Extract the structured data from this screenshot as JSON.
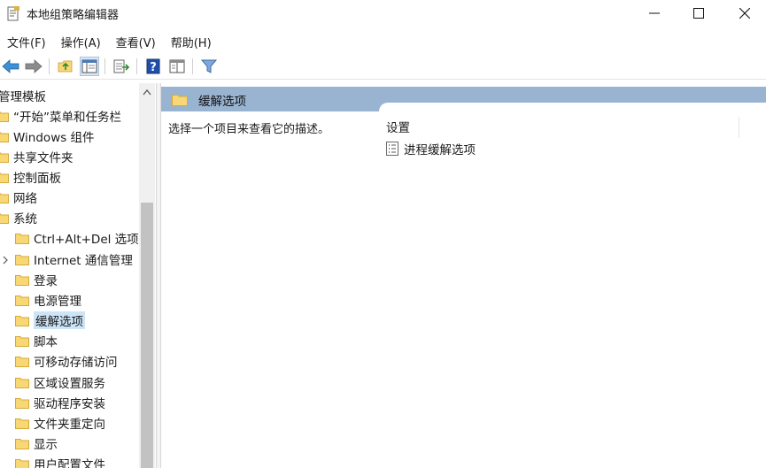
{
  "window": {
    "title": "本地组策略编辑器",
    "controls": {
      "minimize": "minimize",
      "maximize": "maximize",
      "close": "close"
    }
  },
  "menu": [
    {
      "label": "文件(F)"
    },
    {
      "label": "操作(A)"
    },
    {
      "label": "查看(V)"
    },
    {
      "label": "帮助(H)"
    }
  ],
  "toolbar": {
    "buttons": [
      "back-arrow-icon",
      "forward-arrow-icon",
      "up-folder-icon",
      "show-hide-tree-icon",
      "export-list-icon",
      "help-icon",
      "properties-view-icon",
      "filter-icon"
    ]
  },
  "tree": {
    "items": [
      {
        "label": "管理模板",
        "level": 0
      },
      {
        "label": "“开始”菜单和任务栏",
        "level": 1
      },
      {
        "label": "Windows 组件",
        "level": 1
      },
      {
        "label": "共享文件夹",
        "level": 1
      },
      {
        "label": "控制面板",
        "level": 1
      },
      {
        "label": "网络",
        "level": 1
      },
      {
        "label": "系统",
        "level": 1
      },
      {
        "label": "Ctrl+Alt+Del 选项",
        "level": 2
      },
      {
        "label": "Internet 通信管理",
        "level": 2,
        "expandable": true
      },
      {
        "label": "登录",
        "level": 2
      },
      {
        "label": "电源管理",
        "level": 2
      },
      {
        "label": "缓解选项",
        "level": 2,
        "selected": true
      },
      {
        "label": "脚本",
        "level": 2
      },
      {
        "label": "可移动存储访问",
        "level": 2
      },
      {
        "label": "区域设置服务",
        "level": 2
      },
      {
        "label": "驱动程序安装",
        "level": 2
      },
      {
        "label": "文件夹重定向",
        "level": 2
      },
      {
        "label": "显示",
        "level": 2
      },
      {
        "label": "用户配置文件",
        "level": 2
      }
    ]
  },
  "main": {
    "header_title": "缓解选项",
    "description": "选择一个项目来查看它的描述。",
    "settings_header": "设置",
    "settings_items": [
      {
        "label": "进程缓解选项"
      }
    ]
  },
  "colors": {
    "header_band": "#99b4d1",
    "selected_item": "#cce4f7",
    "folder_fill": "#f8d775",
    "folder_edge": "#d8a93a"
  }
}
